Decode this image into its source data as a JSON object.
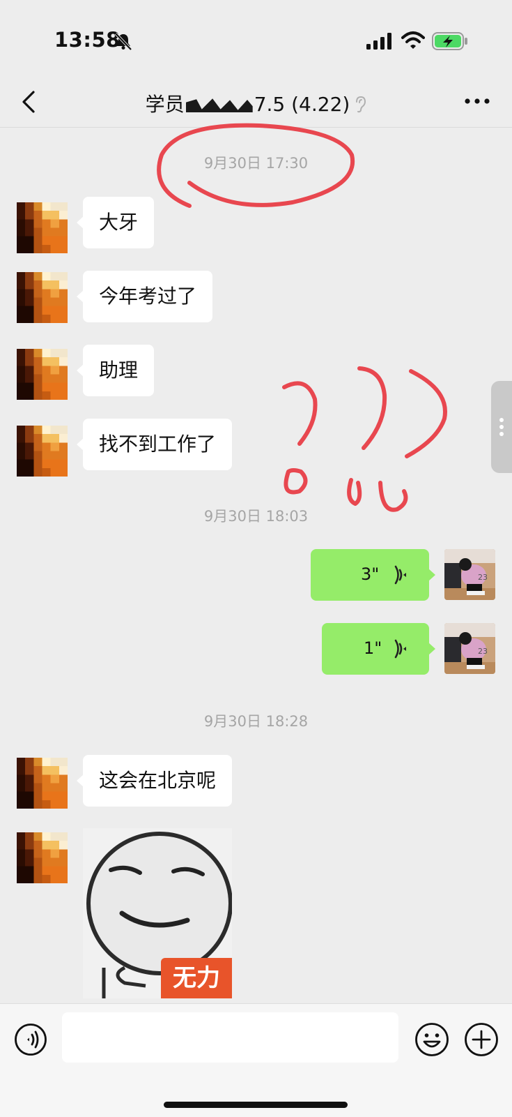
{
  "status_bar": {
    "time": "13:58",
    "battery_charging": true
  },
  "header": {
    "title_prefix": "学员",
    "title_suffix": "7.5 (4.22)",
    "back_icon": "chevron-left-icon",
    "more_icon": "more-icon",
    "ear_icon": "earpiece-icon"
  },
  "timestamps": [
    "9月30日 17:30",
    "9月30日 18:03",
    "9月30日 18:28"
  ],
  "messages": [
    {
      "side": "left",
      "type": "text",
      "text": "大牙"
    },
    {
      "side": "left",
      "type": "text",
      "text": "今年考过了"
    },
    {
      "side": "left",
      "type": "text",
      "text": "助理"
    },
    {
      "side": "left",
      "type": "text",
      "text": "找不到工作了"
    },
    {
      "side": "right",
      "type": "voice",
      "duration": "3\""
    },
    {
      "side": "right",
      "type": "voice",
      "duration": "1\""
    },
    {
      "side": "left",
      "type": "text",
      "text": "这会在北京呢"
    },
    {
      "side": "left",
      "type": "sticker",
      "caption": "无力"
    }
  ],
  "input_bar": {
    "voice_icon": "voice-icon",
    "emoji_icon": "emoji-icon",
    "plus_icon": "plus-icon",
    "placeholder": ""
  },
  "colors": {
    "background": "#ededed",
    "bubble_left": "#ffffff",
    "bubble_right": "#95ec69",
    "annotation": "#e8474f"
  }
}
